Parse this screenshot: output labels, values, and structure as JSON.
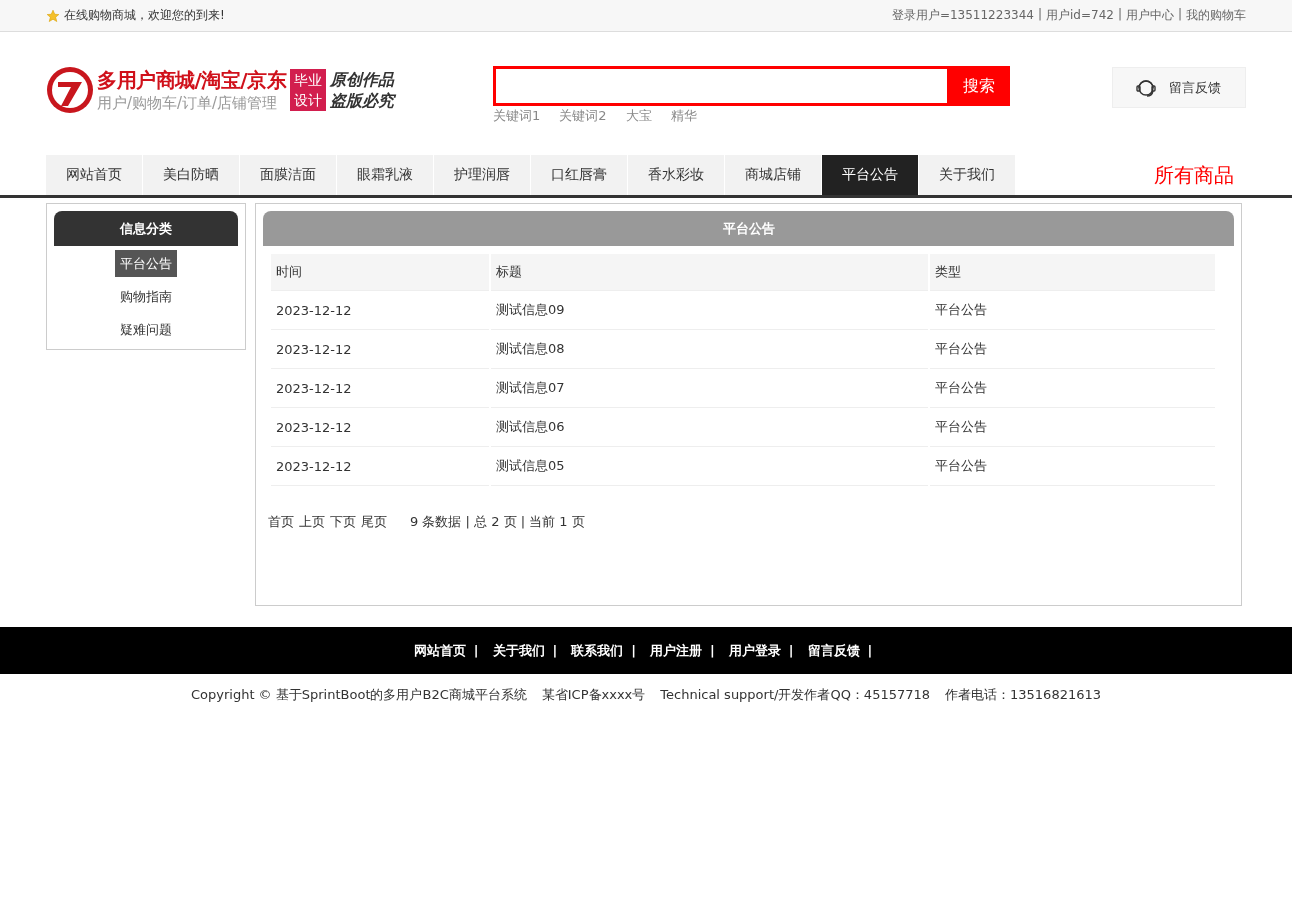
{
  "top_bar": {
    "welcome": "在线购物商城，欢迎您的到来!",
    "separator": "|",
    "links": [
      {
        "label": "登录用户=13511223344"
      },
      {
        "label": "用户id=742"
      },
      {
        "label": "用户中心"
      },
      {
        "label": "我的购物车"
      }
    ]
  },
  "header": {
    "title": "多用户商城/淘宝/京东",
    "subtitle": "用户/购物车/订单/店铺管理",
    "badge_lines": [
      "毕业",
      "设计"
    ],
    "slogan_lines": [
      "原创作品",
      "盗版必究"
    ],
    "search": {
      "button": "搜索"
    },
    "keywords": [
      "关键词1",
      "关键词2",
      "大宝",
      "精华"
    ],
    "feedback": "留言反馈"
  },
  "nav": {
    "tabs": [
      {
        "label": "网站首页",
        "selected": false
      },
      {
        "label": "美白防晒",
        "selected": false
      },
      {
        "label": "面膜洁面",
        "selected": false
      },
      {
        "label": "眼霜乳液",
        "selected": false
      },
      {
        "label": "护理润唇",
        "selected": false
      },
      {
        "label": "口红唇膏",
        "selected": false
      },
      {
        "label": "香水彩妆",
        "selected": false
      },
      {
        "label": "商城店铺",
        "selected": false
      },
      {
        "label": "平台公告",
        "selected": true
      },
      {
        "label": "关于我们",
        "selected": false
      }
    ],
    "all_products": "所有商品"
  },
  "sidebar": {
    "title": "信息分类",
    "items": [
      {
        "label": "平台公告",
        "selected": true
      },
      {
        "label": "购物指南",
        "selected": false
      },
      {
        "label": "疑难问题",
        "selected": false
      }
    ]
  },
  "panel": {
    "title": "平台公告",
    "table": {
      "columns": [
        "时间",
        "标题",
        "类型"
      ],
      "rows": [
        [
          "2023-12-12",
          "测试信息09",
          "平台公告"
        ],
        [
          "2023-12-12",
          "测试信息08",
          "平台公告"
        ],
        [
          "2023-12-12",
          "测试信息07",
          "平台公告"
        ],
        [
          "2023-12-12",
          "测试信息06",
          "平台公告"
        ],
        [
          "2023-12-12",
          "测试信息05",
          "平台公告"
        ]
      ]
    },
    "pagination": {
      "links": [
        "首页",
        "上页",
        "下页",
        "尾页"
      ],
      "summary": "9 条数据 | 总 2 页 | 当前 1 页"
    }
  },
  "footer": {
    "separator": "|",
    "links": [
      "网站首页",
      "关于我们",
      "联系我们",
      "用户注册",
      "用户登录",
      "留言反馈"
    ],
    "copyright": [
      "Copyright © 基于SprintBoot的多用户B2C商城平台系统",
      "某省ICP备xxxx号",
      "Technical support/开发作者QQ：45157718",
      "作者电话：13516821613"
    ]
  }
}
